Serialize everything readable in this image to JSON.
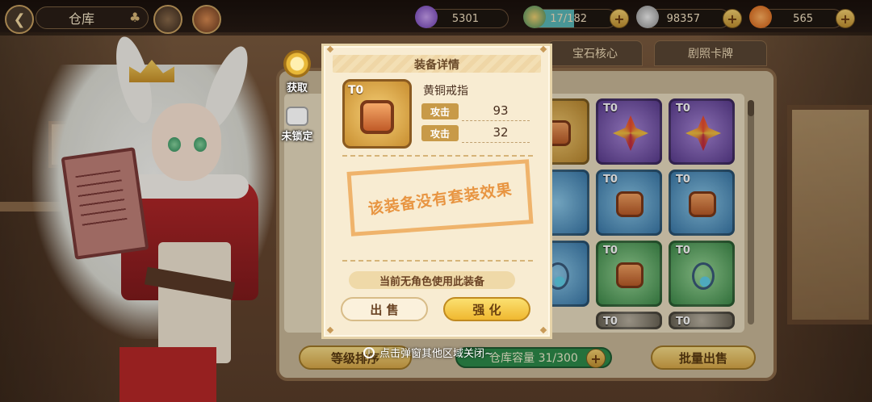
{
  "topbar": {
    "back_icon": "back-arrow-icon",
    "title": "仓库",
    "resources": [
      {
        "name": "purple-crystal",
        "value": "5301",
        "color": "#9a6ad8"
      },
      {
        "name": "stamina",
        "value": "17/182",
        "color": "#60c0c8"
      },
      {
        "name": "gold-coin",
        "value": "98357",
        "color": "#c8c8c8"
      },
      {
        "name": "carrot",
        "value": "565",
        "color": "#f08030"
      }
    ]
  },
  "tabs": [
    {
      "label": "宝石核心"
    },
    {
      "label": "剧照卡牌"
    }
  ],
  "side_actions": {
    "obtain_label": "获取",
    "lock_label": "未锁定"
  },
  "inventory": {
    "tier_label": "T0",
    "sort_label": "等级排序",
    "capacity_label": "仓库容量 31/300",
    "bulk_sell_label": "批量出售"
  },
  "modal": {
    "title": "装备详情",
    "item_tier": "T0",
    "item_name": "黄铜戒指",
    "stats": [
      {
        "label": "攻击",
        "value": "93"
      },
      {
        "label": "攻击",
        "value": "32"
      }
    ],
    "set_effect_text": "该装备没有套装效果",
    "usage_text": "当前无角色使用此装备",
    "sell_label": "出 售",
    "enhance_label": "强 化"
  },
  "hint": {
    "text": "点击弹窗其他区域关闭~"
  },
  "colors": {
    "accent_gold": "#f0b830",
    "panel_bg": "#f8ecd2",
    "stamp_orange": "#e88c32",
    "capacity_green": "#2c8a4a"
  }
}
